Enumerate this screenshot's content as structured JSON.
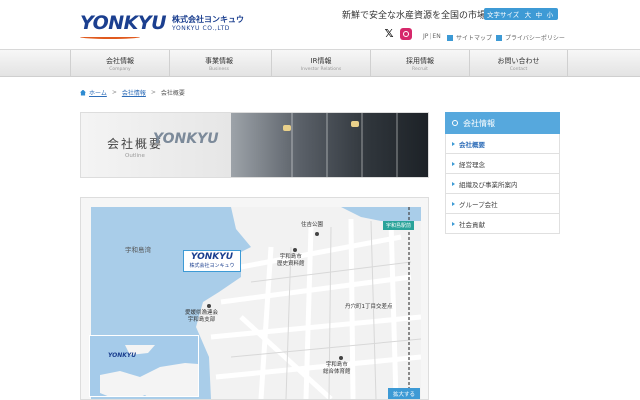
{
  "header": {
    "logo_mark": "YONKYU",
    "logo_jp": "株式会社ヨンキュウ",
    "logo_en": "YONKYU CO.,LTD",
    "tagline": "新鮮で安全な水産資源を全国の市場へ",
    "font_size_label": "文字サイズ",
    "font_sizes": [
      "大",
      "中",
      "小"
    ],
    "lang_jp": "JP",
    "lang_sep": "|",
    "lang_en": "EN",
    "sitemap": "サイトマップ",
    "privacy": "プライバシーポリシー",
    "sns_x_icon": "x-icon",
    "sns_instagram_icon": "instagram-icon"
  },
  "nav": [
    {
      "jp": "会社情報",
      "en": "Company"
    },
    {
      "jp": "事業情報",
      "en": "Business"
    },
    {
      "jp": "IR情報",
      "en": "Investor Relations"
    },
    {
      "jp": "採用情報",
      "en": "Recruit"
    },
    {
      "jp": "お問い合わせ",
      "en": "Contact"
    }
  ],
  "breadcrumb": {
    "home": "ホーム",
    "parent": "会社情報",
    "current": "会社概要",
    "separator": ">"
  },
  "hero": {
    "title": "会社概要",
    "subtitle": "Outline",
    "building_sign": "YONKYU"
  },
  "map": {
    "bay_label": "宇和島湾",
    "park_label": "住吉公園",
    "museum_label": "宇和島市\n歴史資料館",
    "assembly_label": "愛媛県漁連会\n宇和島支部",
    "junction_label": "丹穴町1丁目交差点",
    "gym_label": "宇和島市\n総合体育館",
    "badge": "宇和島駅前",
    "zoom_button": "拡大する",
    "callout_logo": "YONKYU",
    "callout_name": "株式会社ヨンキュウ",
    "inset_logo": "YONKYU",
    "colors": {
      "sea": "#a9cde9",
      "land": "#f2f2f2",
      "road": "#ffffff",
      "block": "#e2e2e2"
    }
  },
  "sidebar": {
    "heading": "会社情報",
    "items": [
      {
        "label": "会社概要",
        "active": true
      },
      {
        "label": "経営理念",
        "active": false
      },
      {
        "label": "組織及び事業所案内",
        "active": false
      },
      {
        "label": "グループ会社",
        "active": false
      },
      {
        "label": "社会貢献",
        "active": false
      }
    ]
  },
  "colors": {
    "brand": "#1b3f8f",
    "accent": "#3d9ad5",
    "sidebar_head": "#56a8dd",
    "logo_wave": "#e05a1e"
  }
}
